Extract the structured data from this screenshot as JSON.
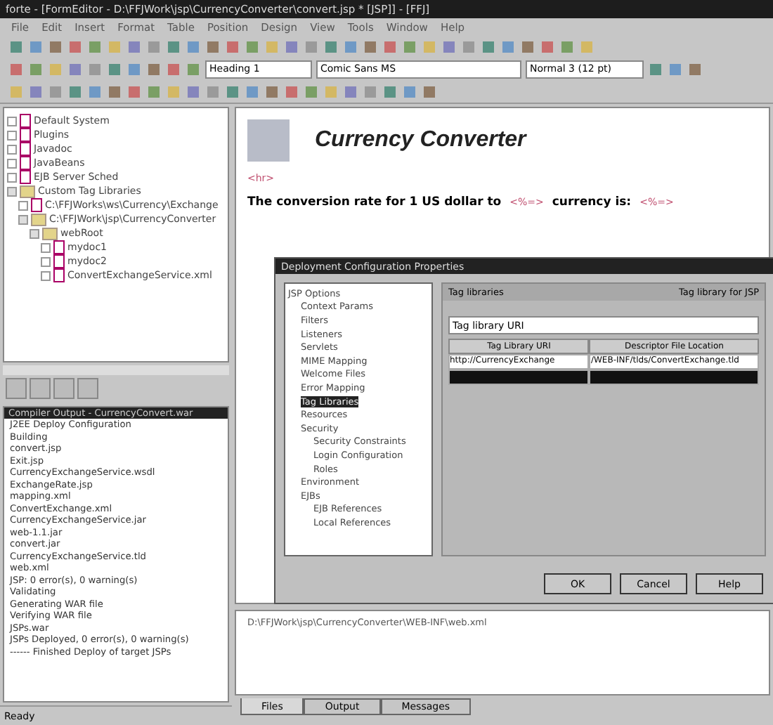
{
  "window": {
    "title": "forte - [FormEditor - D:\\FFJWork\\jsp\\CurrencyConverter\\convert.jsp * [JSP]] - [FFJ]"
  },
  "menu": [
    "File",
    "Edit",
    "Insert",
    "Format",
    "Table",
    "Position",
    "Design",
    "View",
    "Tools",
    "Window",
    "Help"
  ],
  "format_bar": {
    "style": "Heading 1",
    "font": "Comic Sans MS",
    "size": "Normal 3 (12 pt)"
  },
  "explorer": {
    "items": [
      {
        "label": "Default System",
        "expanded": false
      },
      {
        "label": "Plugins",
        "expanded": false
      },
      {
        "label": "Javadoc",
        "expanded": false
      },
      {
        "label": "JavaBeans",
        "expanded": false
      },
      {
        "label": "EJB Server Sched",
        "expanded": false
      },
      {
        "label": "Custom Tag Libraries",
        "expanded": true,
        "children": [
          {
            "label": "C:\\FFJWorks\\ws\\Currency\\Exchange",
            "expanded": false
          },
          {
            "label": "C:\\FFJWork\\jsp\\CurrencyConverter",
            "expanded": true,
            "children": [
              {
                "label": "webRoot",
                "expanded": true,
                "children": [
                  {
                    "label": "mydoc1",
                    "expanded": false
                  },
                  {
                    "label": "mydoc2",
                    "expanded": false
                  },
                  {
                    "label": "ConvertExchangeService.xml",
                    "expanded": false
                  }
                ]
              }
            ]
          }
        ]
      }
    ]
  },
  "output": {
    "header": "Compiler Output - CurrencyConvert.war",
    "lines": [
      "J2EE Deploy Configuration",
      "Building",
      "convert.jsp",
      "Exit.jsp",
      "CurrencyExchangeService.wsdl",
      "ExchangeRate.jsp",
      "mapping.xml",
      "ConvertExchange.xml",
      "CurrencyExchangeService.jar",
      "web-1.1.jar",
      "convert.jar",
      "CurrencyExchangeService.tld",
      "web.xml",
      "JSP: 0 error(s), 0 warning(s)",
      "Validating",
      "Generating WAR file",
      "Verifying WAR file",
      "JSPs.war",
      "JSPs Deployed, 0 error(s), 0 warning(s)",
      "------ Finished Deploy of target JSPs"
    ],
    "status": "Ready"
  },
  "editor": {
    "heading": "Currency Converter",
    "rule_tag": "<hr>",
    "sentence_start": "The conversion rate for 1 US dollar to",
    "tag_1": "<%=>",
    "sentence_end": "currency is:",
    "tag_2": "<%=>"
  },
  "dialog": {
    "title": "Deployment Configuration Properties",
    "tree": [
      {
        "label": "JSP Options",
        "selected": false,
        "children": [
          {
            "label": "Context Params",
            "selected": false
          },
          {
            "label": "Filters",
            "selected": false
          },
          {
            "label": "Listeners",
            "selected": false
          },
          {
            "label": "Servlets",
            "selected": false
          },
          {
            "label": "MIME Mapping",
            "selected": false
          },
          {
            "label": "Welcome Files",
            "selected": false
          },
          {
            "label": "Error Mapping",
            "selected": false
          },
          {
            "label": "Tag Libraries",
            "selected": true
          },
          {
            "label": "Resources",
            "selected": false
          },
          {
            "label": "Security",
            "selected": false,
            "children": [
              {
                "label": "Security Constraints",
                "selected": false
              },
              {
                "label": "Login Configuration",
                "selected": false
              },
              {
                "label": "Roles",
                "selected": false
              }
            ]
          },
          {
            "label": "Environment",
            "selected": false
          },
          {
            "label": "EJBs",
            "selected": false,
            "children": [
              {
                "label": "EJB References",
                "selected": false
              },
              {
                "label": "Local References",
                "selected": false
              }
            ]
          }
        ]
      }
    ],
    "panel_title": "Tag libraries",
    "panel_hint": "Tag library for JSP",
    "combo": "Tag library URI",
    "columns": [
      "Tag Library URI",
      "Descriptor File Location"
    ],
    "rows": [
      {
        "cells": [
          "http://CurrencyExchange",
          "/WEB-INF/tlds/ConvertExchange.tld"
        ],
        "selected": false
      },
      {
        "selected": true
      }
    ],
    "buttons": [
      "OK",
      "Cancel",
      "Help"
    ]
  },
  "bottom_pane": {
    "line": "D:\\FFJWork\\jsp\\CurrencyConverter\\WEB-INF\\web.xml",
    "tabs": [
      {
        "label": "Files",
        "selected": true
      },
      {
        "label": "Output",
        "selected": false
      },
      {
        "label": "Messages",
        "selected": false
      }
    ]
  }
}
